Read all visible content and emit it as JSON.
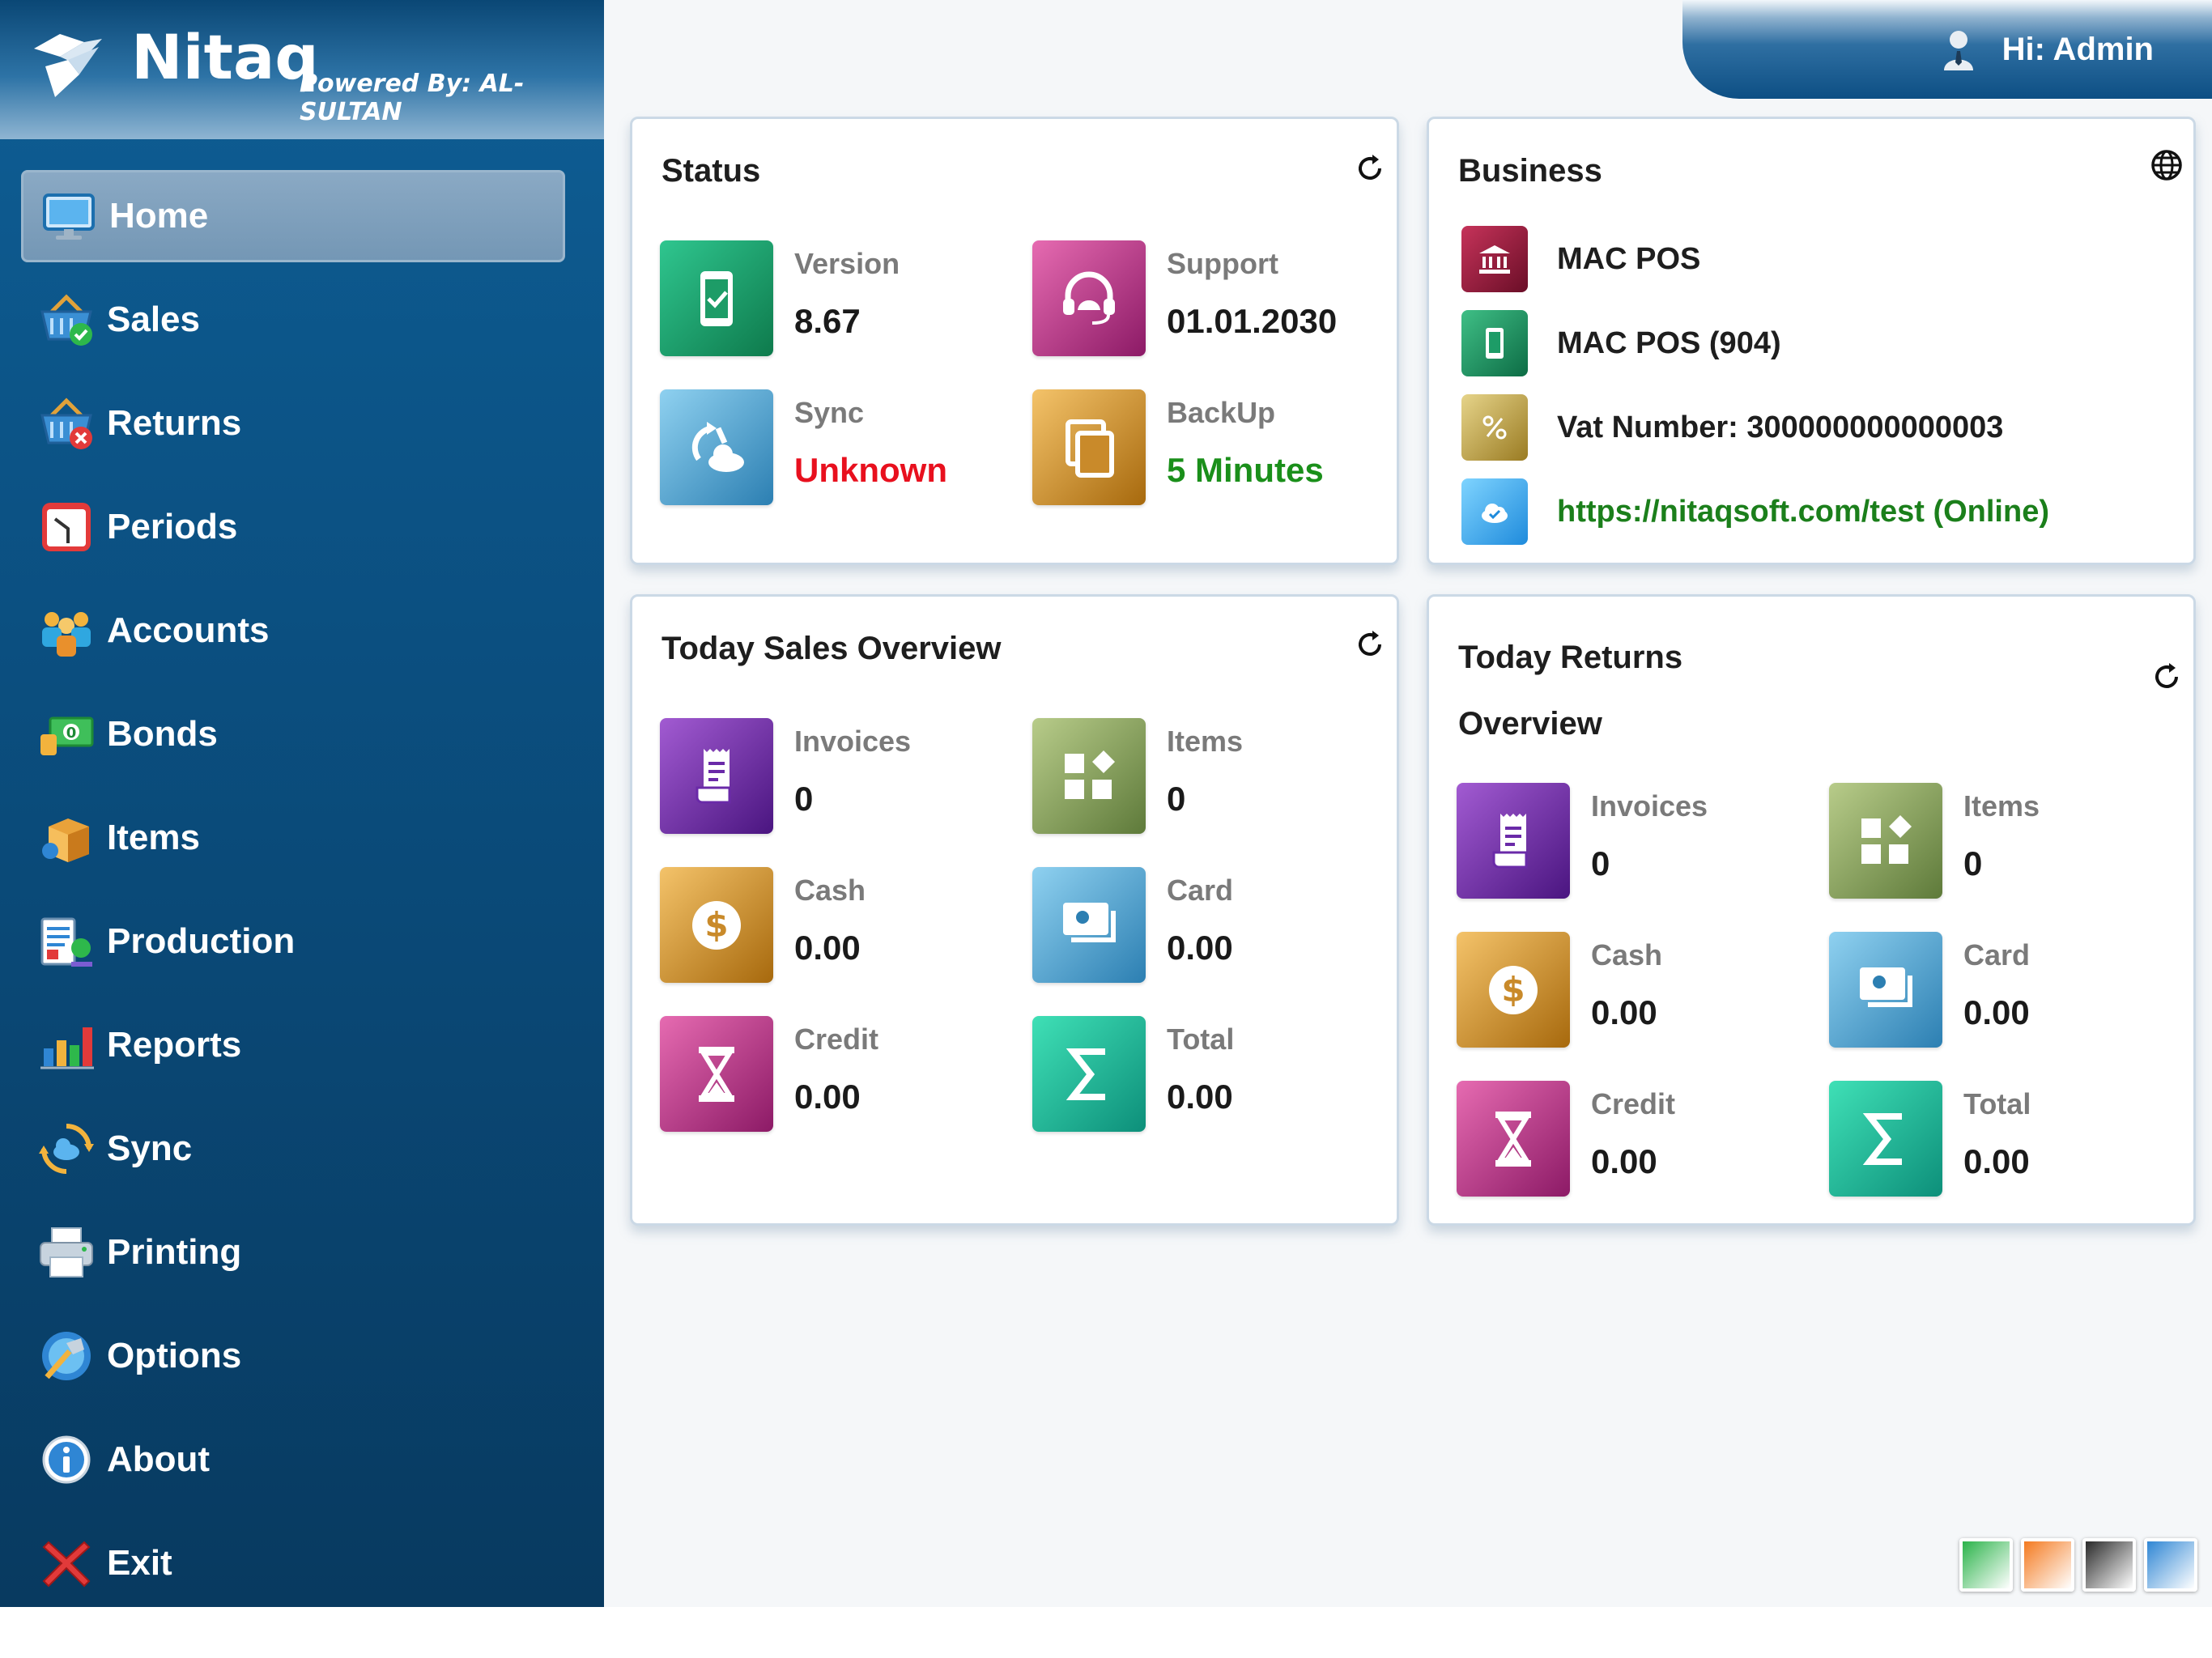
{
  "brand": {
    "name": "Nitaq",
    "tagline": "Powered By: AL-SULTAN"
  },
  "user": {
    "greeting": "Hi: Admin"
  },
  "nav": [
    {
      "label": "Home",
      "icon": "monitor-icon",
      "active": true
    },
    {
      "label": "Sales",
      "icon": "basket-check-icon"
    },
    {
      "label": "Returns",
      "icon": "basket-x-icon"
    },
    {
      "label": "Periods",
      "icon": "clock-icon"
    },
    {
      "label": "Accounts",
      "icon": "people-icon"
    },
    {
      "label": "Bonds",
      "icon": "banknote-icon"
    },
    {
      "label": "Items",
      "icon": "box-icon"
    },
    {
      "label": "Production",
      "icon": "clipboard-icon"
    },
    {
      "label": "Reports",
      "icon": "bar-chart-icon"
    },
    {
      "label": "Sync",
      "icon": "cloud-sync-icon"
    },
    {
      "label": "Printing",
      "icon": "printer-icon"
    },
    {
      "label": "Options",
      "icon": "tools-icon"
    },
    {
      "label": "About",
      "icon": "info-icon"
    },
    {
      "label": "Exit",
      "icon": "close-x-icon"
    }
  ],
  "status": {
    "title": "Status",
    "items": [
      {
        "label": "Version",
        "value": "8.67"
      },
      {
        "label": "Support",
        "value": "01.01.2030"
      },
      {
        "label": "Sync",
        "value": "Unknown",
        "color": "#e8101e"
      },
      {
        "label": "BackUp",
        "value": "5 Minutes",
        "color": "#1a8f1a"
      }
    ]
  },
  "business": {
    "title": "Business",
    "rows": [
      {
        "text": "MAC POS",
        "icon": "bank-icon"
      },
      {
        "text": "MAC POS (904)",
        "icon": "tablet-icon"
      },
      {
        "text": "Vat Number: 300000000000003",
        "icon": "percent-icon"
      },
      {
        "text": "https://nitaqsoft.com/test (Online)",
        "icon": "cloud-icon",
        "color": "#1b7f1b"
      }
    ]
  },
  "sales": {
    "title": "Today Sales Overview",
    "items": [
      {
        "label": "Invoices",
        "value": "0"
      },
      {
        "label": "Items",
        "value": "0"
      },
      {
        "label": "Cash",
        "value": "0.00"
      },
      {
        "label": "Card",
        "value": "0.00"
      },
      {
        "label": "Credit",
        "value": "0.00"
      },
      {
        "label": "Total",
        "value": "0.00"
      }
    ]
  },
  "returns": {
    "title": "Today Returns Overview",
    "items": [
      {
        "label": "Invoices",
        "value": "0"
      },
      {
        "label": "Items",
        "value": "0"
      },
      {
        "label": "Cash",
        "value": "0.00"
      },
      {
        "label": "Card",
        "value": "0.00"
      },
      {
        "label": "Credit",
        "value": "0.00"
      },
      {
        "label": "Total",
        "value": "0.00"
      }
    ]
  },
  "themes": [
    {
      "name": "green-theme",
      "color": "#2bb34a"
    },
    {
      "name": "orange-theme",
      "color": "#f47a20"
    },
    {
      "name": "black-theme",
      "color": "#2a2a2a"
    },
    {
      "name": "blue-theme",
      "color": "#2f86d4"
    }
  ]
}
